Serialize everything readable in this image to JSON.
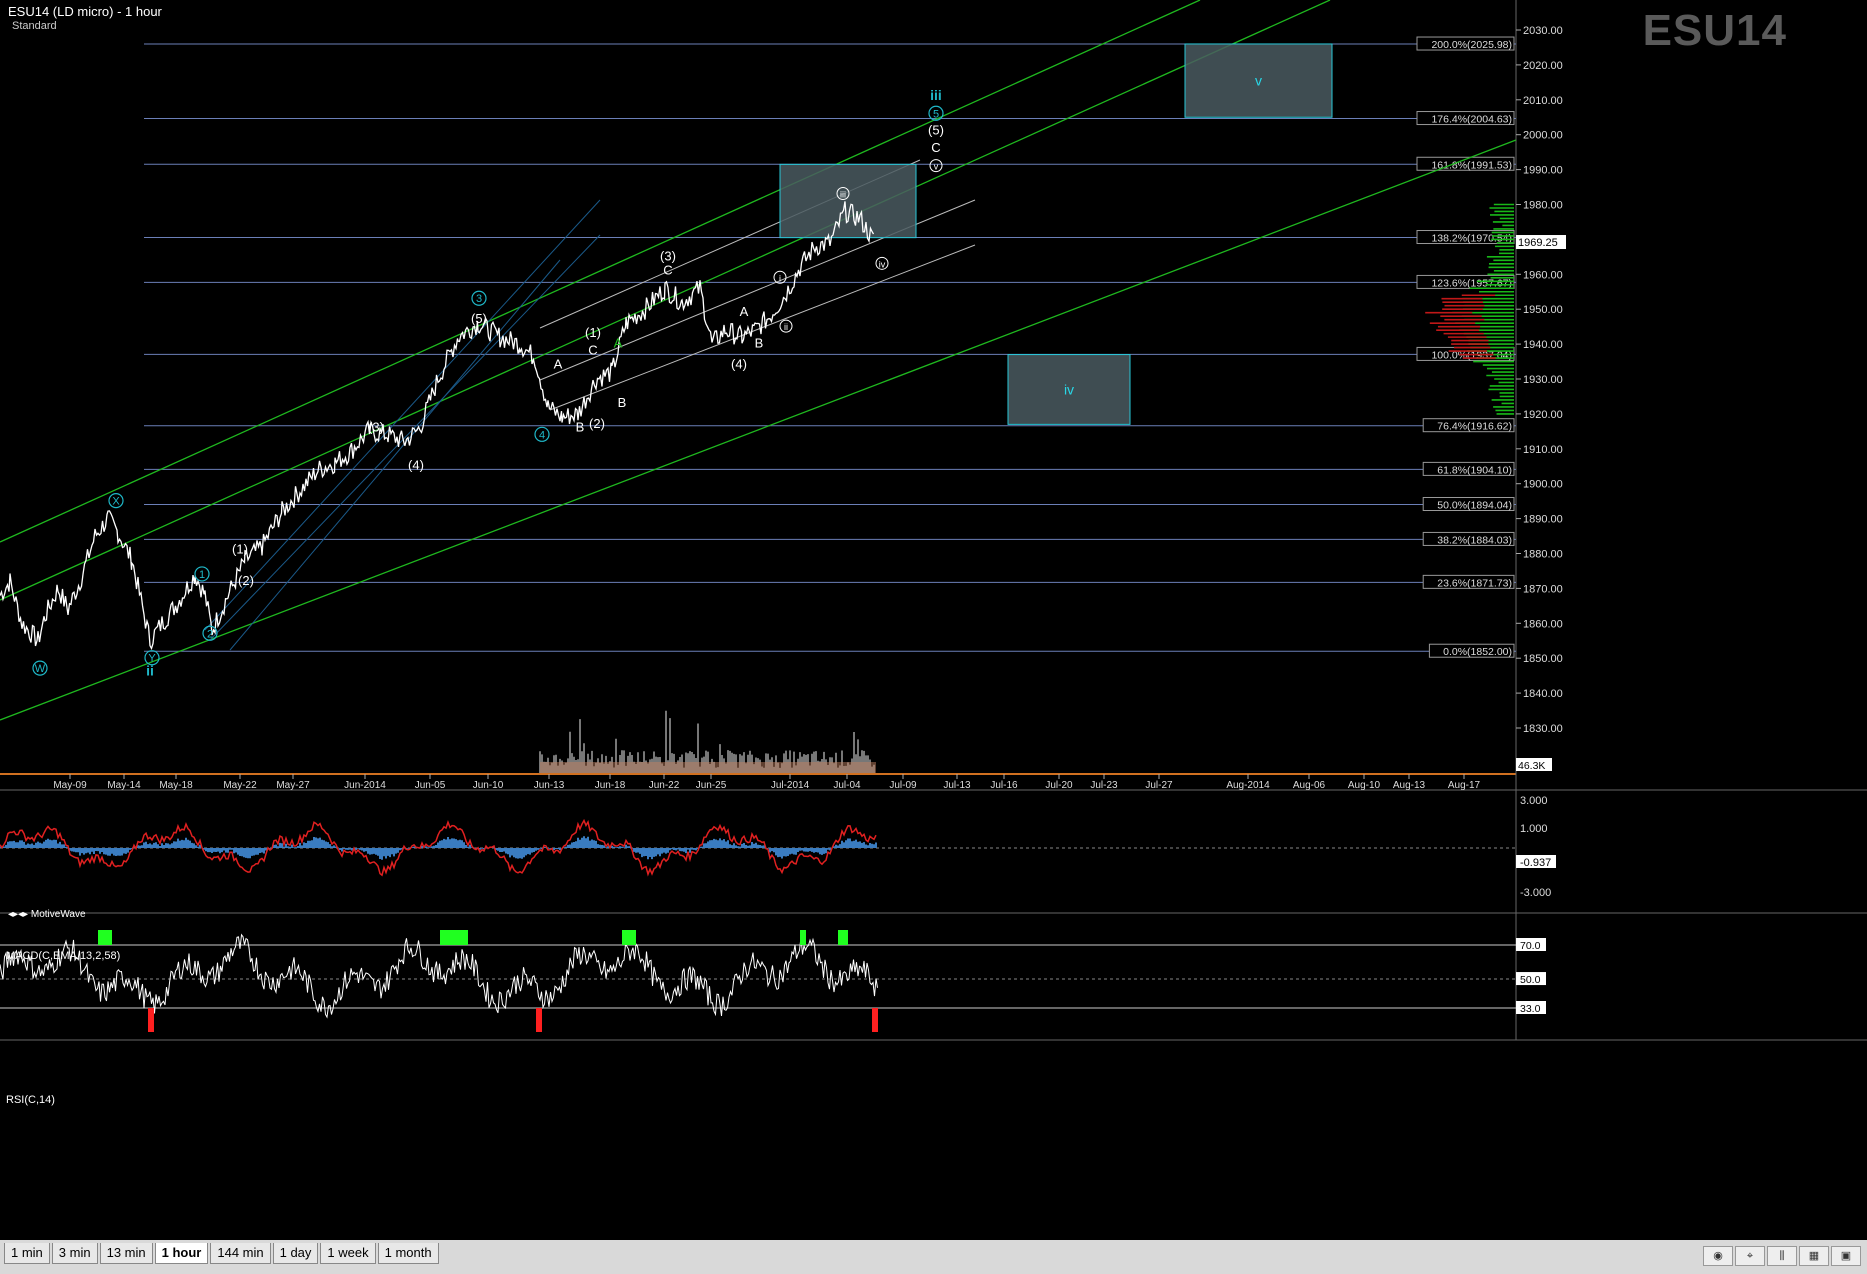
{
  "header": {
    "title": "ESU14 (LD micro) - 1 hour",
    "subtitle": "Standard",
    "watermark": "ESU14",
    "branding": "MotiveWave"
  },
  "colors": {
    "background": "#000000",
    "price": "#ffffff",
    "fib_line": "#6b7fb8",
    "channel_green": "#1fb81f",
    "wave_cyan": "#1fb8c8",
    "box_fill": "#4a5a60",
    "box_border": "#28c8d8",
    "macd": "#e02020",
    "macd_hist": "#3a7cc0",
    "rsi_over": "#20ff20",
    "rsi_under": "#ff2020",
    "volume": "#c08060"
  },
  "chart_data": [
    {
      "type": "line",
      "title": "ESU14 (LD micro) - 1 hour",
      "ylim": [
        1815,
        2035
      ],
      "yticks": [
        "2030.00",
        "2020.00",
        "2010.00",
        "2000.00",
        "1990.00",
        "1980.00",
        "1970.00",
        "1960.00",
        "1950.00",
        "1940.00",
        "1930.00",
        "1920.00",
        "1910.00",
        "1900.00",
        "1890.00",
        "1880.00",
        "1870.00",
        "1860.00",
        "1850.00",
        "1840.00",
        "1830.00"
      ],
      "ytick_values": [
        2030,
        2020,
        2010,
        2000,
        1990,
        1980,
        1970,
        1960,
        1950,
        1940,
        1930,
        1920,
        1910,
        1900,
        1890,
        1880,
        1870,
        1860,
        1850,
        1840,
        1830
      ],
      "xticks": [
        "May-09",
        "May-14",
        "May-18",
        "May-22",
        "May-27",
        "Jun-2014",
        "Jun-05",
        "Jun-10",
        "Jun-13",
        "Jun-18",
        "Jun-22",
        "Jun-25",
        "Jul-2014",
        "Jul-04",
        "Jul-09",
        "Jul-13",
        "Jul-16",
        "Jul-20",
        "Jul-23",
        "Jul-27",
        "Aug-2014",
        "Aug-06",
        "Aug-10",
        "Aug-13",
        "Aug-17"
      ],
      "last_price": "1969.25",
      "volume_label": "46.3K",
      "price_path": [
        [
          0,
          1868
        ],
        [
          10,
          1872
        ],
        [
          22,
          1860
        ],
        [
          38,
          1855
        ],
        [
          45,
          1862
        ],
        [
          58,
          1870
        ],
        [
          68,
          1864
        ],
        [
          80,
          1872
        ],
        [
          95,
          1885
        ],
        [
          108,
          1890
        ],
        [
          118,
          1886
        ],
        [
          132,
          1878
        ],
        [
          150,
          1855
        ],
        [
          162,
          1860
        ],
        [
          178,
          1866
        ],
        [
          195,
          1874
        ],
        [
          205,
          1868
        ],
        [
          212,
          1858
        ],
        [
          228,
          1868
        ],
        [
          245,
          1878
        ],
        [
          262,
          1882
        ],
        [
          282,
          1892
        ],
        [
          300,
          1898
        ],
        [
          318,
          1904
        ],
        [
          335,
          1906
        ],
        [
          350,
          1909
        ],
        [
          368,
          1915
        ],
        [
          388,
          1914
        ],
        [
          405,
          1912
        ],
        [
          420,
          1916
        ],
        [
          438,
          1930
        ],
        [
          458,
          1942
        ],
        [
          478,
          1946
        ],
        [
          500,
          1942
        ],
        [
          520,
          1940
        ],
        [
          535,
          1936
        ],
        [
          548,
          1922
        ],
        [
          562,
          1919
        ],
        [
          578,
          1920
        ],
        [
          596,
          1930
        ],
        [
          612,
          1932
        ],
        [
          626,
          1946
        ],
        [
          645,
          1950
        ],
        [
          665,
          1956
        ],
        [
          682,
          1952
        ],
        [
          700,
          1956
        ],
        [
          712,
          1940
        ],
        [
          725,
          1944
        ],
        [
          742,
          1942
        ],
        [
          755,
          1944
        ],
        [
          770,
          1948
        ],
        [
          785,
          1954
        ],
        [
          800,
          1962
        ],
        [
          815,
          1968
        ],
        [
          830,
          1969
        ],
        [
          845,
          1978
        ],
        [
          860,
          1976
        ],
        [
          875,
          1969
        ]
      ],
      "fib_levels": [
        {
          "label": "200.0%(2025.98)",
          "value": 2025.98
        },
        {
          "label": "176.4%(2004.63)",
          "value": 2004.63
        },
        {
          "label": "161.8%(1991.53)",
          "value": 1991.53
        },
        {
          "label": "138.2%(1970.54)",
          "value": 1970.54
        },
        {
          "label": "123.6%(1957.67)",
          "value": 1957.67
        },
        {
          "label": "100.0%(1937.04)",
          "value": 1937.04
        },
        {
          "label": "76.4%(1916.62)",
          "value": 1916.62
        },
        {
          "label": "61.8%(1904.10)",
          "value": 1904.1
        },
        {
          "label": "50.0%(1894.04)",
          "value": 1894.04
        },
        {
          "label": "38.2%(1884.03)",
          "value": 1884.03
        },
        {
          "label": "23.6%(1871.73)",
          "value": 1871.73
        },
        {
          "label": "0.0%(1852.00)",
          "value": 1852.0
        }
      ],
      "target_boxes": [
        {
          "label": "v",
          "x": [
            1185,
            1332
          ],
          "y": [
            2005,
            2026
          ]
        },
        {
          "label": "iv",
          "x": [
            1008,
            1130
          ],
          "y": [
            1917,
            1937
          ]
        },
        {
          "label": "",
          "x": [
            780,
            916
          ],
          "y": [
            1970.5,
            1991.5
          ]
        }
      ],
      "wave_labels": [
        {
          "text": "W",
          "x": 40,
          "value": 1846,
          "cyan": true
        },
        {
          "text": "X",
          "x": 116,
          "value": 1894,
          "cyan": true
        },
        {
          "text": "Y",
          "x": 152,
          "value": 1849,
          "cyan": true
        },
        {
          "text": "ii",
          "x": 150,
          "value": 1845,
          "cyan": true,
          "plain": true
        },
        {
          "text": "1",
          "x": 202,
          "value": 1873,
          "cyan": true
        },
        {
          "text": "2",
          "x": 210,
          "value": 1856,
          "cyan": true
        },
        {
          "text": "(1)",
          "x": 240,
          "value": 1880,
          "cyan": false
        },
        {
          "text": "(2)",
          "x": 246,
          "value": 1871,
          "cyan": false
        },
        {
          "text": "(3)",
          "x": 376,
          "value": 1915,
          "cyan": false
        },
        {
          "text": "(4)",
          "x": 416,
          "value": 1904,
          "cyan": false
        },
        {
          "text": "3",
          "x": 479,
          "value": 1952,
          "cyan": true
        },
        {
          "text": "(5)",
          "x": 479,
          "value": 1946,
          "cyan": false
        },
        {
          "text": "4",
          "x": 542,
          "value": 1913,
          "cyan": true
        },
        {
          "text": "A",
          "x": 558,
          "value": 1933,
          "cyan": false
        },
        {
          "text": "B",
          "x": 580,
          "value": 1915,
          "cyan": false
        },
        {
          "text": "(1)",
          "x": 593,
          "value": 1942,
          "cyan": false
        },
        {
          "text": "C",
          "x": 593,
          "value": 1937,
          "cyan": false
        },
        {
          "text": "(2)",
          "x": 597,
          "value": 1916,
          "cyan": false
        },
        {
          "text": "A",
          "x": 618,
          "value": 1939,
          "cyan": false,
          "green": true
        },
        {
          "text": "B",
          "x": 622,
          "value": 1922,
          "cyan": false
        },
        {
          "text": "(3)",
          "x": 668,
          "value": 1964,
          "cyan": false
        },
        {
          "text": "C",
          "x": 668,
          "value": 1960,
          "cyan": false
        },
        {
          "text": "A",
          "x": 744,
          "value": 1948,
          "cyan": false
        },
        {
          "text": "B",
          "x": 759,
          "value": 1939,
          "cyan": false
        },
        {
          "text": "(4)",
          "x": 739,
          "value": 1933,
          "cyan": false
        },
        {
          "text": "i",
          "x": 780,
          "value": 1958,
          "cyan": false,
          "circle": true
        },
        {
          "text": "ii",
          "x": 786,
          "value": 1944,
          "cyan": false,
          "circle": true
        },
        {
          "text": "iii",
          "x": 843,
          "value": 1982,
          "cyan": false,
          "circle": true
        },
        {
          "text": "iv",
          "x": 882,
          "value": 1962,
          "cyan": false,
          "circle": true
        },
        {
          "text": "v",
          "x": 936,
          "value": 1990,
          "cyan": false,
          "circle": true
        },
        {
          "text": "C",
          "x": 936,
          "value": 1995,
          "cyan": false
        },
        {
          "text": "(5)",
          "x": 936,
          "value": 2000,
          "cyan": false
        },
        {
          "text": "5",
          "x": 936,
          "value": 2005,
          "cyan": true
        },
        {
          "text": "iii",
          "x": 936,
          "value": 2010,
          "cyan": true,
          "plain": true
        }
      ]
    },
    {
      "type": "line",
      "title": "MACD(C,EMA,13,2,58)",
      "yticks": [
        "3.000",
        "1.000",
        "-0.937",
        "-3.000"
      ],
      "ytick_values": [
        3.0,
        1.0,
        -0.937,
        -3.0
      ],
      "last_value": "-0.937"
    },
    {
      "type": "line",
      "title": "RSI(C,14)",
      "yticks": [
        "70.0",
        "50.0",
        "33.0"
      ],
      "ytick_values": [
        70,
        50,
        33
      ],
      "last_value": "33.0"
    }
  ],
  "tabs": [
    {
      "label": "1 min",
      "active": false
    },
    {
      "label": "3 min",
      "active": false
    },
    {
      "label": "13 min",
      "active": false
    },
    {
      "label": "1 hour",
      "active": true
    },
    {
      "label": "144 min",
      "active": false
    },
    {
      "label": "1 day",
      "active": false
    },
    {
      "label": "1 week",
      "active": false
    },
    {
      "label": "1 month",
      "active": false
    }
  ],
  "toolbar_icons": [
    "eye-icon",
    "cursor-icon",
    "bars-icon",
    "calendar-icon",
    "window-icon"
  ]
}
